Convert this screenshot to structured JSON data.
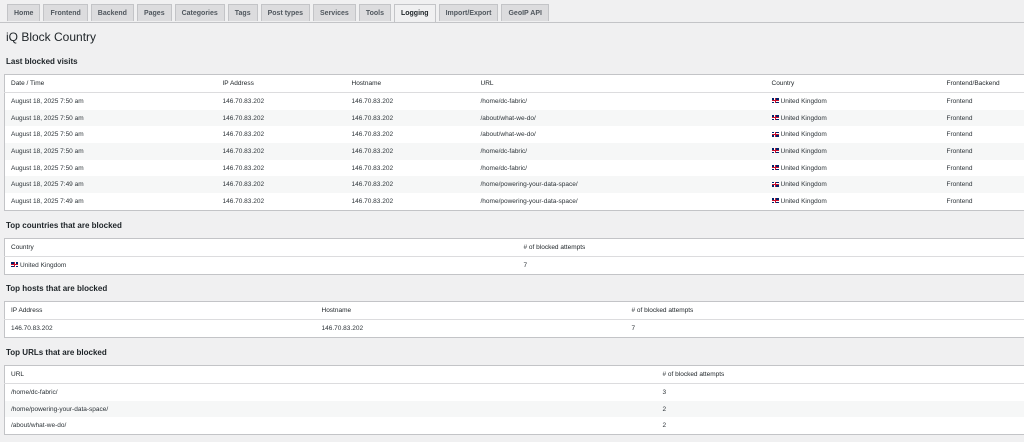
{
  "tabs": [
    {
      "label": "Home"
    },
    {
      "label": "Frontend"
    },
    {
      "label": "Backend"
    },
    {
      "label": "Pages"
    },
    {
      "label": "Categories"
    },
    {
      "label": "Tags"
    },
    {
      "label": "Post types"
    },
    {
      "label": "Services"
    },
    {
      "label": "Tools"
    },
    {
      "label": "Logging"
    },
    {
      "label": "Import/Export"
    },
    {
      "label": "GeoIP API"
    }
  ],
  "active_tab": "Logging",
  "page_title": "iQ Block Country",
  "visits": {
    "title": "Last blocked visits",
    "headers": [
      "Date / Time",
      "IP Address",
      "Hostname",
      "URL",
      "Country",
      "Frontend/Backend"
    ],
    "rows": [
      {
        "datetime": "August 18, 2025 7:50 am",
        "ip": "146.70.83.202",
        "host": "146.70.83.202",
        "url": "/home/dc-fabric/",
        "country": "United Kingdom",
        "side": "Frontend"
      },
      {
        "datetime": "August 18, 2025 7:50 am",
        "ip": "146.70.83.202",
        "host": "146.70.83.202",
        "url": "/about/what-we-do/",
        "country": "United Kingdom",
        "side": "Frontend"
      },
      {
        "datetime": "August 18, 2025 7:50 am",
        "ip": "146.70.83.202",
        "host": "146.70.83.202",
        "url": "/about/what-we-do/",
        "country": "United Kingdom",
        "side": "Frontend"
      },
      {
        "datetime": "August 18, 2025 7:50 am",
        "ip": "146.70.83.202",
        "host": "146.70.83.202",
        "url": "/home/dc-fabric/",
        "country": "United Kingdom",
        "side": "Frontend"
      },
      {
        "datetime": "August 18, 2025 7:50 am",
        "ip": "146.70.83.202",
        "host": "146.70.83.202",
        "url": "/home/dc-fabric/",
        "country": "United Kingdom",
        "side": "Frontend"
      },
      {
        "datetime": "August 18, 2025 7:49 am",
        "ip": "146.70.83.202",
        "host": "146.70.83.202",
        "url": "/home/powering-your-data-space/",
        "country": "United Kingdom",
        "side": "Frontend"
      },
      {
        "datetime": "August 18, 2025 7:49 am",
        "ip": "146.70.83.202",
        "host": "146.70.83.202",
        "url": "/home/powering-your-data-space/",
        "country": "United Kingdom",
        "side": "Frontend"
      }
    ]
  },
  "countries": {
    "title": "Top countries that are blocked",
    "headers": [
      "Country",
      "# of blocked attempts"
    ],
    "rows": [
      {
        "country": "United Kingdom",
        "count": "7"
      }
    ]
  },
  "hosts": {
    "title": "Top hosts that are blocked",
    "headers": [
      "IP Address",
      "Hostname",
      "# of blocked attempts"
    ],
    "rows": [
      {
        "ip": "146.70.83.202",
        "host": "146.70.83.202",
        "count": "7"
      }
    ]
  },
  "urls": {
    "title": "Top URLs that are blocked",
    "headers": [
      "URL",
      "# of blocked attempts"
    ],
    "rows": [
      {
        "url": "/home/dc-fabric/",
        "count": "3"
      },
      {
        "url": "/home/powering-your-data-space/",
        "count": "2"
      },
      {
        "url": "/about/what-we-do/",
        "count": "2"
      }
    ]
  }
}
